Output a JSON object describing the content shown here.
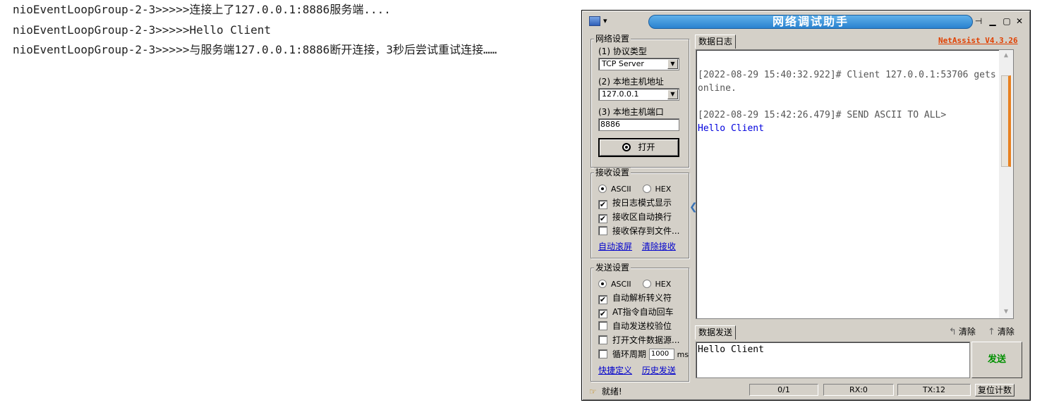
{
  "console": {
    "lines": [
      "nioEventLoopGroup-2-3>>>>>连接上了127.0.0.1:8886服务端....",
      "nioEventLoopGroup-2-3>>>>>Hello Client",
      "nioEventLoopGroup-2-3>>>>>与服务端127.0.0.1:8886断开连接，3秒后尝试重试连接……"
    ]
  },
  "window": {
    "title": "网络调试助手",
    "version": "NetAssist V4.3.26",
    "tb_pin": "ꟷ",
    "tb_min": "▬",
    "tb_max": "☐",
    "tb_close": "✕"
  },
  "net_settings": {
    "legend": "网络设置",
    "protocol_label": "(1) 协议类型",
    "protocol_value": "TCP Server",
    "host_label": "(2) 本地主机地址",
    "host_value": "127.0.0.1",
    "port_label": "(3) 本地主机端口",
    "port_value": "8886",
    "open_button": "打开"
  },
  "recv_settings": {
    "legend": "接收设置",
    "ascii": "ASCII",
    "hex": "HEX",
    "log_mode": "按日志模式显示",
    "auto_wrap": "接收区自动换行",
    "save_to_file": "接收保存到文件...",
    "auto_scroll": "自动滚屏",
    "clear_recv": "清除接收"
  },
  "send_settings": {
    "legend": "发送设置",
    "ascii": "ASCII",
    "hex": "HEX",
    "escape": "自动解析转义符",
    "at_cr": "AT指令自动回车",
    "checksum": "自动发送校验位",
    "file_source": "打开文件数据源...",
    "loop": "循环周期",
    "loop_ms": "1000",
    "ms": "ms",
    "shortcut": "快捷定义",
    "history": "历史发送"
  },
  "log": {
    "tab": "数据日志",
    "lines": [
      "[2022-08-29 15:40:32.922]# Client 127.0.0.1:53706 gets",
      "online.",
      "",
      "[2022-08-29 15:42:26.479]# SEND ASCII TO ALL>",
      "Hello Client"
    ]
  },
  "send": {
    "tab": "数据发送",
    "clear1": "清除",
    "clear2": "清除",
    "text": "Hello Client",
    "button": "发送"
  },
  "status": {
    "ready": "就绪!",
    "count": "0/1",
    "rx": "RX:0",
    "tx": "TX:12",
    "reset": "复位计数"
  }
}
